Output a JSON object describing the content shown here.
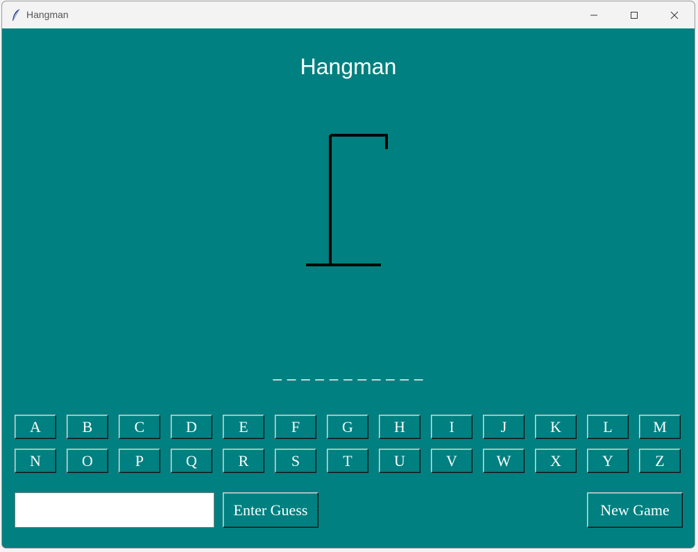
{
  "window": {
    "title": "Hangman"
  },
  "game": {
    "title": "Hangman",
    "word_display": "_ _ _ _ _ _ _ _ _ _ _",
    "letters_row1": [
      "A",
      "B",
      "C",
      "D",
      "E",
      "F",
      "G",
      "H",
      "I",
      "J",
      "K",
      "L",
      "M"
    ],
    "letters_row2": [
      "N",
      "O",
      "P",
      "Q",
      "R",
      "S",
      "T",
      "U",
      "V",
      "W",
      "X",
      "Y",
      "Z"
    ],
    "guess_input_value": "",
    "enter_guess_label": "Enter Guess",
    "new_game_label": "New Game"
  },
  "colors": {
    "background": "#008080",
    "text": "#ffffff",
    "gallows": "#000000"
  },
  "icons": {
    "app": "feather-icon",
    "minimize": "minimize-icon",
    "maximize": "maximize-icon",
    "close": "close-icon"
  }
}
